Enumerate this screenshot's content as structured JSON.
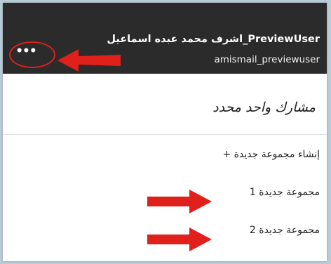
{
  "header": {
    "user_name": "اشرف محمد عبده اسماعيل_PreviewUser",
    "user_id": "amismail_previewuser",
    "more_icon": "more-horizontal-icon"
  },
  "panel": {
    "title": "مشارك واحد محدد",
    "create_group": "+ إنشاء مجموعة جديدة",
    "groups": [
      "مجموعة جديدة 1",
      "مجموعة جديدة 2"
    ]
  },
  "colors": {
    "header_bg": "#2b2b2b",
    "annotation_red": "#e0201a",
    "background": "#b9cdd6"
  }
}
